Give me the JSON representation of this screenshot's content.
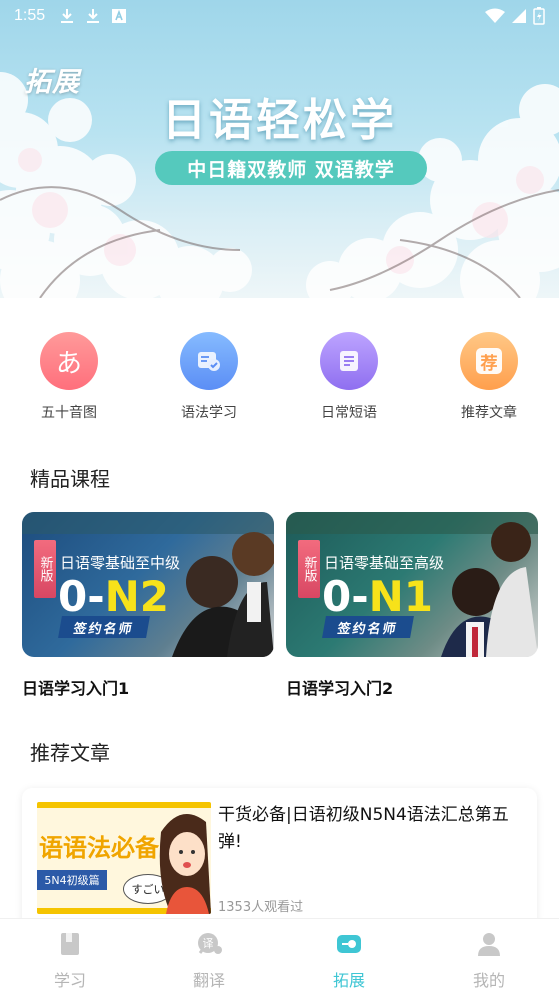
{
  "status_bar": {
    "time": "1:55",
    "left_icons": [
      "download-icon",
      "download-icon",
      "font-icon"
    ],
    "right_icons": [
      "wifi-icon",
      "signal-icon",
      "battery-icon"
    ]
  },
  "banner": {
    "tag": "拓展",
    "title": "日语轻松学",
    "subtitle": "中日籍双教师 双语教学"
  },
  "quick_actions": [
    {
      "label": "五十音图",
      "icon": "kana-icon",
      "glyph": "あ",
      "color_from": "#ff8d8d",
      "color_to": "#ff6f7c"
    },
    {
      "label": "语法学习",
      "icon": "grammar-icon",
      "glyph": "",
      "color_from": "#7fb6ff",
      "color_to": "#5b8ef5"
    },
    {
      "label": "日常短语",
      "icon": "phrase-icon",
      "glyph": "",
      "color_from": "#b499ff",
      "color_to": "#8f6ff0"
    },
    {
      "label": "推荐文章",
      "icon": "recommend-icon",
      "glyph": "荐",
      "color_from": "#ffc27a",
      "color_to": "#ff9f4d"
    }
  ],
  "sections": {
    "courses_title": "精品课程",
    "articles_title": "推荐文章"
  },
  "courses": [
    {
      "name": "日语学习入门1",
      "badge": "新版",
      "subtitle": "日语零基础至中级",
      "level_prefix": "0-",
      "level": "N2",
      "sign": "签约名师"
    },
    {
      "name": "日语学习入门2",
      "badge": "新版",
      "subtitle": "日语零基础至高级",
      "level_prefix": "0-",
      "level": "N1",
      "sign": "签约名师"
    }
  ],
  "article": {
    "title": "干货必备|日语初级N5N4语法汇总第五弹!",
    "views": "1353人观看过",
    "thumb_title": "语语法必备",
    "thumb_tag": "5N4初级篇",
    "thumb_bubble": "すごい"
  },
  "bottom_nav": [
    {
      "label": "学习",
      "icon": "book-icon",
      "active": false
    },
    {
      "label": "翻译",
      "icon": "translate-icon",
      "active": false
    },
    {
      "label": "拓展",
      "icon": "expand-icon",
      "active": true
    },
    {
      "label": "我的",
      "icon": "user-icon",
      "active": false
    }
  ],
  "colors": {
    "accent": "#3fc6d4",
    "banner_pill": "#55c9bd",
    "inactive_nav": "#b5b5b5"
  }
}
